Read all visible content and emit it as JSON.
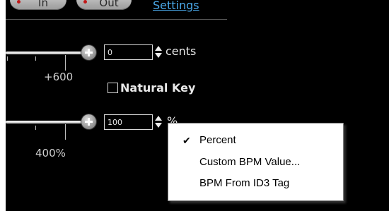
{
  "top_bar": {
    "in_label": "In",
    "out_label": "Out",
    "settings_label": "Settings"
  },
  "pitch": {
    "value": "0",
    "unit": "cents",
    "scale_label": "+600",
    "natural_key_label": "Natural Key",
    "natural_key_checked": false
  },
  "tempo": {
    "value": "100",
    "unit": "%",
    "scale_label": "400%"
  },
  "context_menu": {
    "items": [
      {
        "label": "Percent",
        "checked": true
      },
      {
        "label": "Custom BPM Value...",
        "checked": false
      },
      {
        "label": "BPM From ID3 Tag",
        "checked": false
      }
    ]
  },
  "check_glyph": "✔"
}
